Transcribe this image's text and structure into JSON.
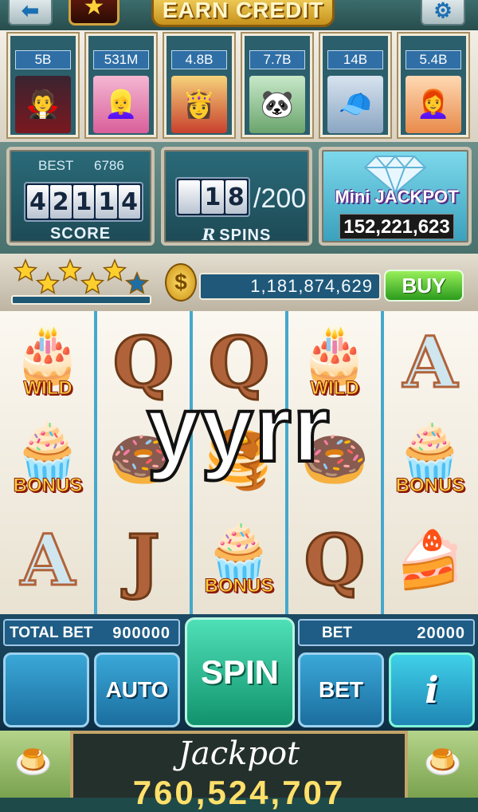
{
  "header": {
    "back_icon": "back-arrow-icon",
    "badge_icon": "star-rank-icon",
    "earn_credit_label": "EARN CREDIT",
    "settings_icon": "gear-icon"
  },
  "players": [
    {
      "credit": "5B",
      "avatar": "vampire-avatar"
    },
    {
      "credit": "531M",
      "avatar": "blonde-girl-avatar"
    },
    {
      "credit": "4.8B",
      "avatar": "princess-avatar"
    },
    {
      "credit": "7.7B",
      "avatar": "panda-avatar"
    },
    {
      "credit": "14B",
      "avatar": "cap-boy-avatar"
    },
    {
      "credit": "5.4B",
      "avatar": "redhead-girl-avatar"
    }
  ],
  "score_panel": {
    "best_label": "BEST",
    "best_value": "6786",
    "score_digits": [
      "4",
      "2",
      "1",
      "1",
      "4"
    ],
    "label": "SCORE"
  },
  "spins_panel": {
    "digits": [
      "",
      "1",
      "8"
    ],
    "total": "/200",
    "label": "SPINS"
  },
  "mini_jackpot": {
    "title": "Mini JACKPOT",
    "value": "152,221,623"
  },
  "level": {
    "stars_filled": 5,
    "stars_total": 6
  },
  "coins": {
    "balance": "1,181,874,629",
    "buy_label": "BUY"
  },
  "reels": [
    [
      {
        "type": "cake",
        "tag": "WILD"
      },
      {
        "type": "tea-stand",
        "tag": "BONUS"
      },
      {
        "type": "letter",
        "letter": "A"
      }
    ],
    [
      {
        "type": "letter",
        "letter": "Q"
      },
      {
        "type": "donut"
      },
      {
        "type": "letter",
        "letter": "J"
      }
    ],
    [
      {
        "type": "letter",
        "letter": "Q"
      },
      {
        "type": "pancake"
      },
      {
        "type": "tea-stand",
        "tag": "BONUS"
      }
    ],
    [
      {
        "type": "cake",
        "tag": "WILD"
      },
      {
        "type": "donut"
      },
      {
        "type": "letter",
        "letter": "Q"
      }
    ],
    [
      {
        "type": "letter",
        "letter": "A"
      },
      {
        "type": "tea-stand",
        "tag": "BONUS"
      },
      {
        "type": "chocolate-cake"
      }
    ]
  ],
  "overlay_text": "yyrr",
  "controls": {
    "total_bet_label": "TOTAL BET",
    "total_bet_value": "900000",
    "bet_label": "BET",
    "bet_value": "20000",
    "auto_label": "AUTO",
    "spin_label": "SPIN",
    "bet_button_label": "BET",
    "info_label": "i"
  },
  "jackpot": {
    "title": "Jackpot",
    "value": "760,524,707"
  },
  "colors": {
    "accent": "#45a8cc",
    "spin_button": "#11936d",
    "buy_button": "#2c9b1d",
    "coin_gold": "#ffe06a"
  }
}
